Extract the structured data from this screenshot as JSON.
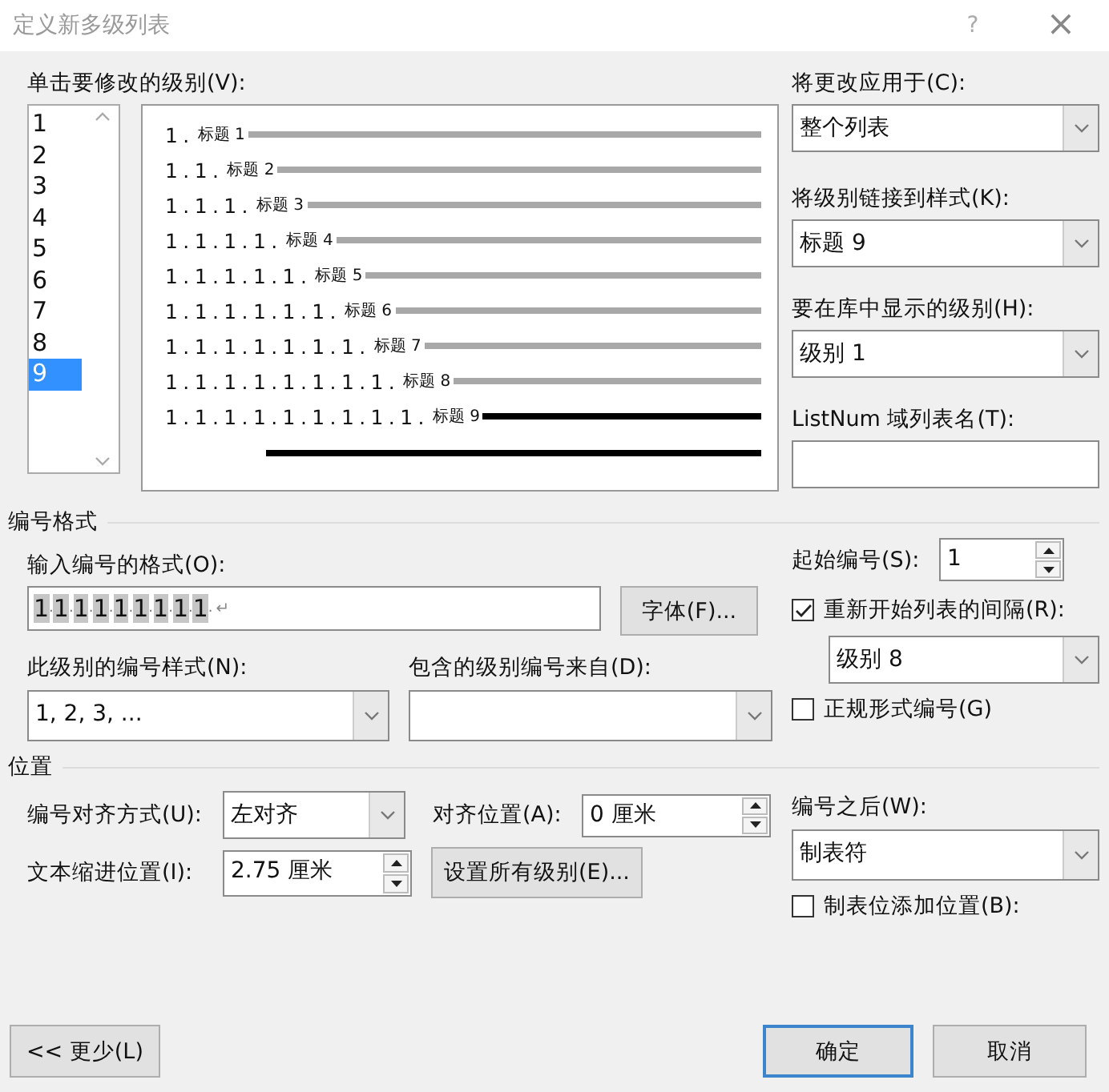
{
  "window": {
    "title": "定义新多级列表",
    "help": "?",
    "close": "×"
  },
  "levels": {
    "label": "单击要修改的级别(V):",
    "items": [
      {
        "label": "1",
        "selected": false
      },
      {
        "label": "2",
        "selected": false
      },
      {
        "label": "3",
        "selected": false
      },
      {
        "label": "4",
        "selected": false
      },
      {
        "label": "5",
        "selected": false
      },
      {
        "label": "6",
        "selected": false
      },
      {
        "label": "7",
        "selected": false
      },
      {
        "label": "8",
        "selected": false
      },
      {
        "label": "9",
        "selected": true
      }
    ]
  },
  "preview": {
    "rows": [
      {
        "number": "1.",
        "style": "标题 1",
        "selected": false
      },
      {
        "number": "1.1.",
        "style": "标题 2",
        "selected": false
      },
      {
        "number": "1.1.1.",
        "style": "标题 3",
        "selected": false
      },
      {
        "number": "1.1.1.1.",
        "style": "标题 4",
        "selected": false
      },
      {
        "number": "1.1.1.1.1.",
        "style": "标题 5",
        "selected": false
      },
      {
        "number": "1.1.1.1.1.1.",
        "style": "标题 6",
        "selected": false
      },
      {
        "number": "1.1.1.1.1.1.1.",
        "style": "标题 7",
        "selected": false
      },
      {
        "number": "1.1.1.1.1.1.1.1.",
        "style": "标题 8",
        "selected": false
      },
      {
        "number": "1.1.1.1.1.1.1.1.1.",
        "style": "标题 9",
        "selected": true
      }
    ]
  },
  "apply_to": {
    "label": "将更改应用于(C):",
    "value": "整个列表"
  },
  "link_style": {
    "label": "将级别链接到样式(K):",
    "value": "标题 9"
  },
  "gallery_level": {
    "label": "要在库中显示的级别(H):",
    "value": "级别 1"
  },
  "listnum": {
    "label": "ListNum 域列表名(T):"
  },
  "number_format": {
    "heading": "编号格式",
    "format_label": "输入编号的格式(O):",
    "format_value": "1.1.1.1.1.1.1.1.1.",
    "paragraph_mark": "↵",
    "font_button": "字体(F)...",
    "style_label": "此级别的编号样式(N):",
    "style_value": "1, 2, 3, ...",
    "include_label": "包含的级别编号来自(D):",
    "start_label": "起始编号(S):",
    "start_value": "1",
    "restart": {
      "label": "重新开始列表的间隔(R):",
      "checked": true
    },
    "restart_value": "级别 8",
    "legal": {
      "label": "正规形式编号(G)",
      "checked": false
    }
  },
  "position": {
    "heading": "位置",
    "align_label": "编号对齐方式(U):",
    "align_value": "左对齐",
    "at_label": "对齐位置(A):",
    "at_value": "0 厘米",
    "indent_label": "文本缩进位置(I):",
    "indent_value": "2.75 厘米",
    "set_all_button": "设置所有级别(E)...",
    "follow_label": "编号之后(W):",
    "follow_value": "制表符",
    "tab_stop": {
      "label": "制表位添加位置(B):",
      "checked": false
    }
  },
  "buttons": {
    "less": "<< 更少(L)",
    "ok": "确定",
    "cancel": "取消"
  }
}
